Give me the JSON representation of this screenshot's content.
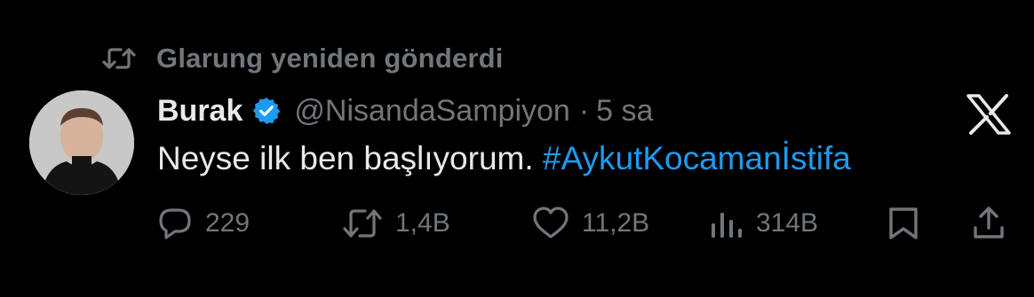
{
  "repost": {
    "icon": "repost-icon",
    "text": "Glarung yeniden gönderdi"
  },
  "author": {
    "name": "Burak",
    "verified_icon": "verified-badge-icon",
    "handle": "@NisandaSampiyon",
    "separator": "·",
    "time": "5 sa"
  },
  "tweet": {
    "text": "Neyse ilk ben başlıyorum. ",
    "hashtag": "#AykutKocamanİstifa"
  },
  "platform_icon": "x-logo-icon",
  "actions": {
    "reply": {
      "icon": "reply-icon",
      "count": "229"
    },
    "repost": {
      "icon": "repost-icon",
      "count": "1,4B"
    },
    "like": {
      "icon": "heart-icon",
      "count": "11,2B"
    },
    "views": {
      "icon": "analytics-icon",
      "count": "314B"
    },
    "bookmark": {
      "icon": "bookmark-icon"
    },
    "share": {
      "icon": "share-icon"
    }
  },
  "colors": {
    "background": "#000000",
    "primary_text": "#e7e9ea",
    "secondary_text": "#71767b",
    "accent": "#1d9bf0"
  }
}
